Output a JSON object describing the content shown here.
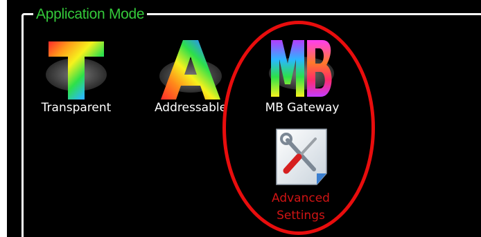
{
  "group": {
    "title": "Application Mode"
  },
  "modes": [
    {
      "id": "transparent",
      "label": "Transparent",
      "icon": "letter-t-rainbow-icon"
    },
    {
      "id": "addressable",
      "label": "Addressable",
      "icon": "letter-a-rainbow-icon"
    },
    {
      "id": "mbgateway",
      "label": "MB Gateway",
      "icon": "letters-mb-rainbow-icon"
    }
  ],
  "advanced": {
    "label_line1": "Advanced",
    "label_line2": "Settings",
    "icon": "wrench-screwdriver-settings-icon"
  },
  "colors": {
    "background": "#000000",
    "group_title": "#34c93a",
    "label_text": "#ffffff",
    "advanced_label": "#d01414",
    "highlight_ellipse": "#e80d0d"
  }
}
